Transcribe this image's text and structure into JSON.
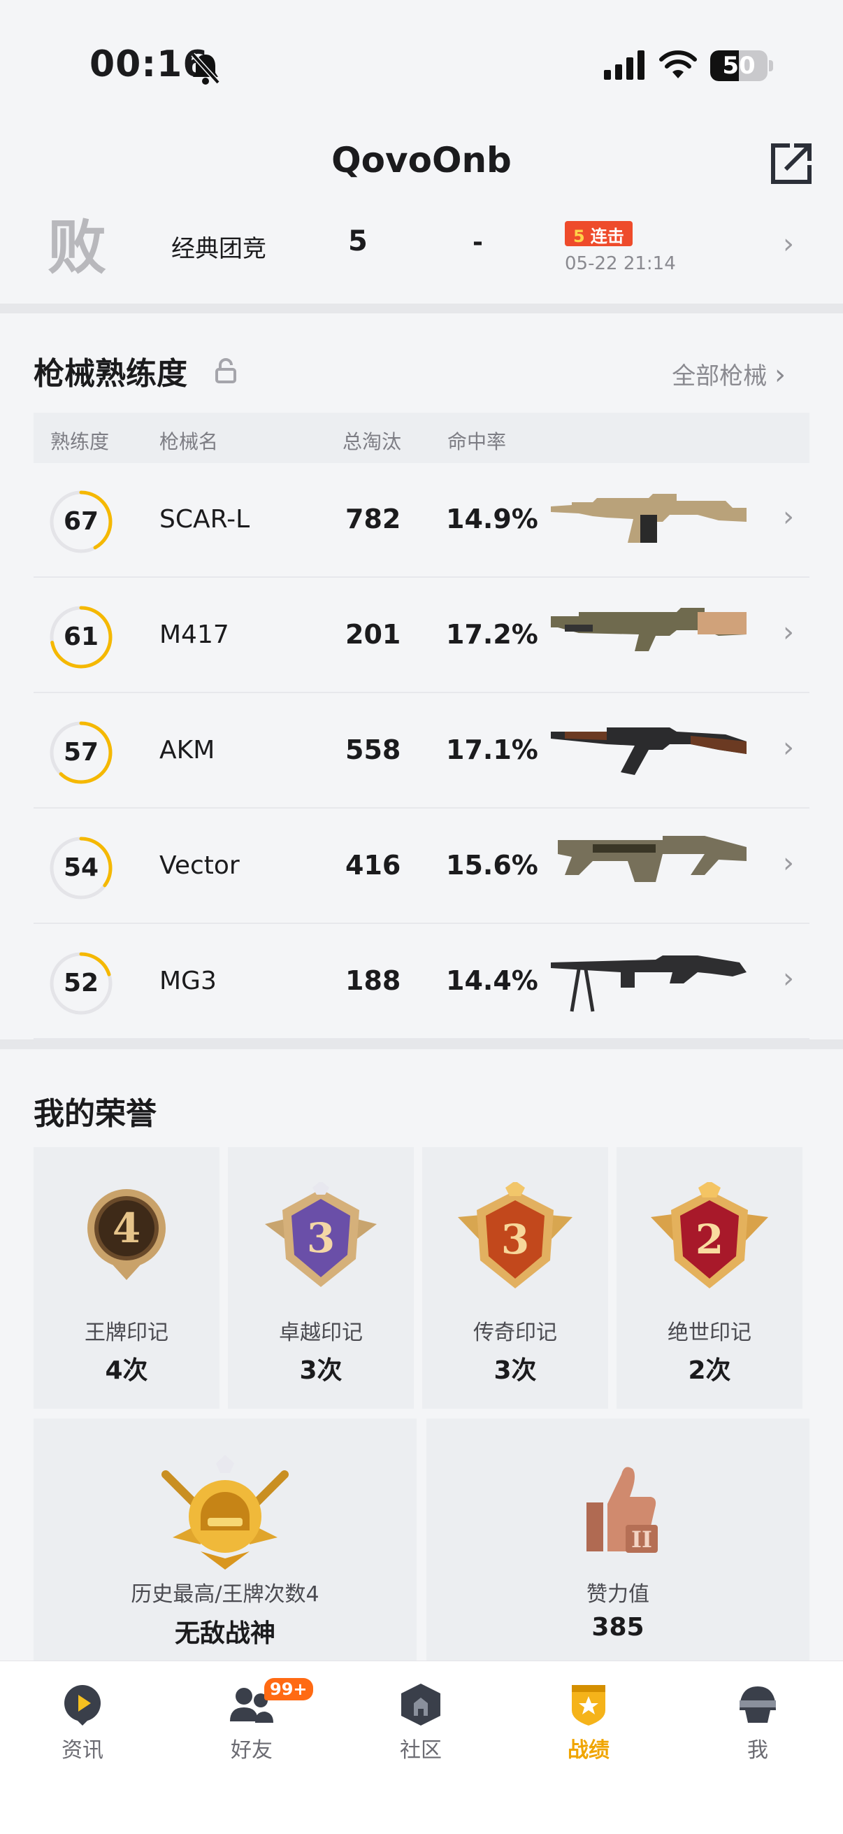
{
  "status_bar": {
    "time": "00:16",
    "battery": "50",
    "battery_level": 0.5
  },
  "header": {
    "title": "QovoOnb"
  },
  "last_match": {
    "result_badge": "败",
    "mode": "经典团竞",
    "kills": "5",
    "placement": "-",
    "streak_count": "5",
    "streak_label": "连击",
    "time": "05-22 21:14"
  },
  "weapons": {
    "title": "枪械熟练度",
    "all_link": "全部枪械",
    "headers": {
      "mastery": "熟练度",
      "name": "枪械名",
      "kills": "总淘汰",
      "accuracy": "命中率"
    },
    "rows": [
      {
        "mastery": "67",
        "progress": 0.42,
        "name": "SCAR-L",
        "kills": "782",
        "accuracy": "14.9%",
        "icon": "scar-l-rifle",
        "color": "#b9a27a"
      },
      {
        "mastery": "61",
        "progress": 0.72,
        "name": "M417",
        "kills": "201",
        "accuracy": "17.2%",
        "icon": "m417-rifle",
        "color": "#6f6a4e"
      },
      {
        "mastery": "57",
        "progress": 0.62,
        "name": "AKM",
        "kills": "558",
        "accuracy": "17.1%",
        "icon": "akm-rifle",
        "color": "#6b3a22"
      },
      {
        "mastery": "54",
        "progress": 0.35,
        "name": "Vector",
        "kills": "416",
        "accuracy": "15.6%",
        "icon": "vector-smg",
        "color": "#77705a"
      },
      {
        "mastery": "52",
        "progress": 0.2,
        "name": "MG3",
        "kills": "188",
        "accuracy": "14.4%",
        "icon": "mg3-machinegun",
        "color": "#2e2e30"
      }
    ]
  },
  "honors": {
    "title": "我的荣誉",
    "cards": [
      {
        "name": "王牌印记",
        "count": "4次",
        "badge_num": "4",
        "icon": "ace-mark-icon"
      },
      {
        "name": "卓越印记",
        "count": "3次",
        "badge_num": "3",
        "icon": "excellence-mark-icon"
      },
      {
        "name": "传奇印记",
        "count": "3次",
        "badge_num": "3",
        "icon": "legend-mark-icon"
      },
      {
        "name": "绝世印记",
        "count": "2次",
        "badge_num": "2",
        "icon": "peerless-mark-icon"
      }
    ],
    "best_rank": {
      "label": "历史最高/王牌次数4",
      "value": "无敌战神"
    },
    "likes": {
      "label": "赞力值",
      "value": "385",
      "badge_num": "II"
    }
  },
  "tabbar": {
    "items": [
      {
        "label": "资讯",
        "icon": "news-icon",
        "active": false
      },
      {
        "label": "好友",
        "icon": "friends-icon",
        "active": false,
        "badge": "99+"
      },
      {
        "label": "社区",
        "icon": "community-icon",
        "active": false
      },
      {
        "label": "战绩",
        "icon": "record-icon",
        "active": true
      },
      {
        "label": "我",
        "icon": "profile-helmet-icon",
        "active": false
      }
    ]
  },
  "colors": {
    "accent": "#f0a500",
    "ring": "#f5b800",
    "streak": "#ee4b2b",
    "badge": "#ff6a13"
  }
}
